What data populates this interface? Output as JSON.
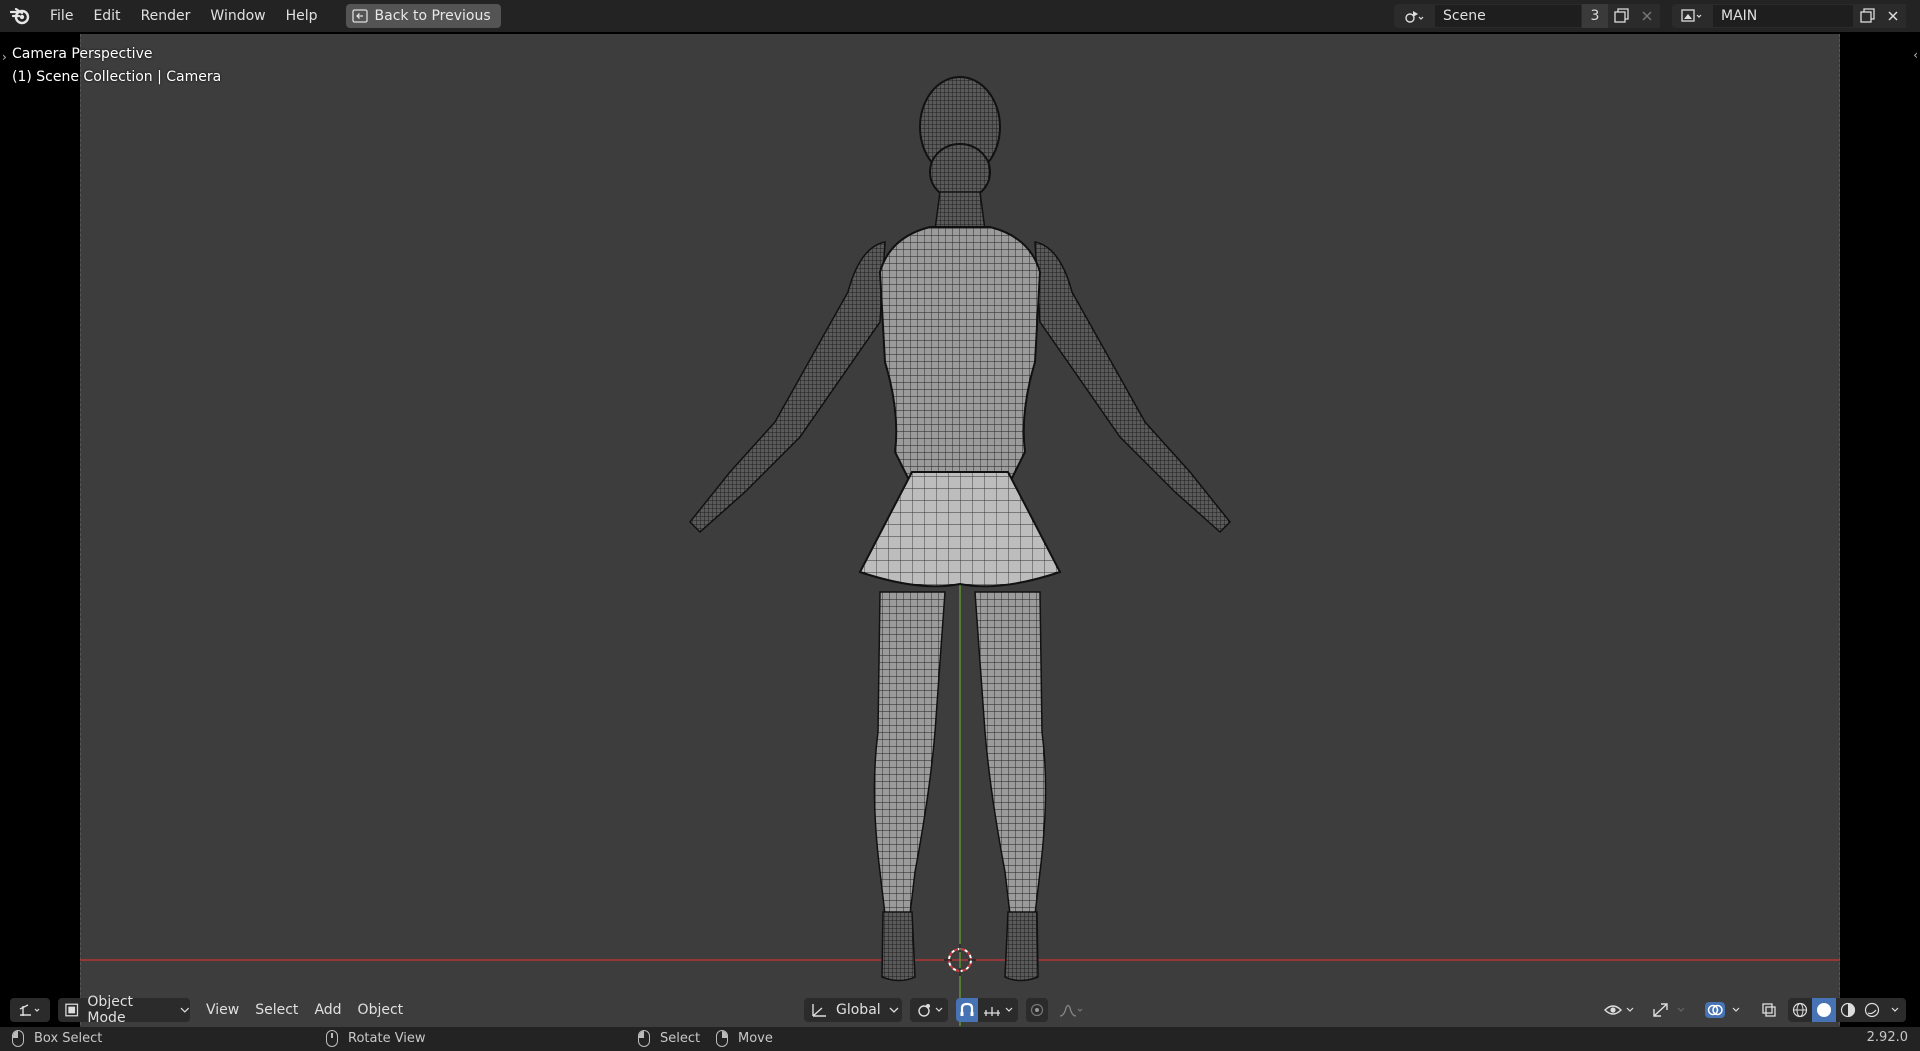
{
  "menu": {
    "items": [
      "File",
      "Edit",
      "Render",
      "Window",
      "Help"
    ],
    "back_button": "Back to Previous"
  },
  "scene": {
    "name": "Scene",
    "user_count": "3",
    "view_layer": "MAIN"
  },
  "viewport": {
    "title": "Camera Perspective",
    "collection": "(1) Scene Collection | Camera"
  },
  "header": {
    "mode": "Object Mode",
    "menus": [
      "View",
      "Select",
      "Add",
      "Object"
    ],
    "orientation": "Global"
  },
  "status": {
    "left": "Box Select",
    "middle": "Rotate View",
    "select": "Select",
    "move": "Move",
    "version": "2.92.0"
  },
  "colors": {
    "accent": "#4772b3",
    "x_axis": "#d03a3a",
    "y_axis": "#6aa334",
    "viewport_bg": "#3d3d3d"
  },
  "icons": [
    "blender-logo-icon",
    "back-arrow-icon",
    "scene-type-icon",
    "new-scene-icon",
    "close-icon",
    "view-layer-icon",
    "editor-type-icon",
    "object-mode-icon",
    "global-axes-icon",
    "pivot-icon",
    "snap-icon",
    "snap-increment-icon",
    "proportional-edit-icon",
    "falloff-icon",
    "visibility-icon",
    "gizmo-icon",
    "overlay-icon",
    "xray-icon",
    "wireframe-shading-icon",
    "solid-shading-icon",
    "material-shading-icon",
    "rendered-shading-icon"
  ]
}
